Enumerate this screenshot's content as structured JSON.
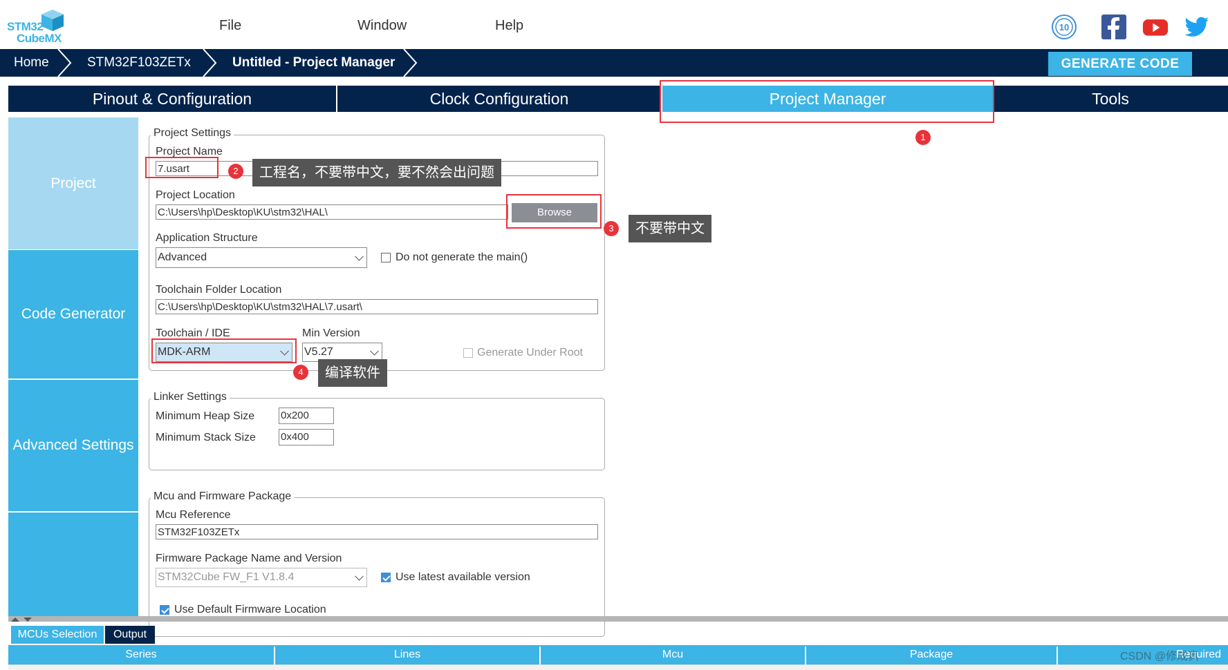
{
  "app": {
    "logo_line1": "STM32",
    "logo_line2": "CubeMX",
    "menu": [
      "File",
      "Window",
      "Help"
    ]
  },
  "breadcrumb": [
    "Home",
    "STM32F103ZETx",
    "Untitled - Project Manager"
  ],
  "generate_button": "GENERATE CODE",
  "tabs": [
    "Pinout & Configuration",
    "Clock Configuration",
    "Project Manager",
    "Tools"
  ],
  "sidebar": [
    "Project",
    "Code Generator",
    "Advanced Settings"
  ],
  "project_settings": {
    "legend": "Project Settings",
    "name_label": "Project Name",
    "name_value": "7.usart",
    "location_label": "Project Location",
    "location_value": "C:\\Users\\hp\\Desktop\\KU\\stm32\\HAL\\",
    "browse_label": "Browse",
    "app_structure_label": "Application Structure",
    "app_structure_value": "Advanced",
    "no_main_label": "Do not generate the main()",
    "toolchain_folder_label": "Toolchain Folder Location",
    "toolchain_folder_value": "C:\\Users\\hp\\Desktop\\KU\\stm32\\HAL\\7.usart\\",
    "toolchain_label": "Toolchain / IDE",
    "toolchain_value": "MDK-ARM",
    "min_version_label": "Min Version",
    "min_version_value": "V5.27",
    "gen_under_root_label": "Generate Under Root"
  },
  "linker_settings": {
    "legend": "Linker Settings",
    "heap_label": "Minimum Heap Size",
    "heap_value": "0x200",
    "stack_label": "Minimum Stack Size",
    "stack_value": "0x400"
  },
  "mcu_package": {
    "legend": "Mcu and Firmware Package",
    "ref_label": "Mcu Reference",
    "ref_value": "STM32F103ZETx",
    "fw_label": "Firmware Package Name and Version",
    "fw_value": "STM32Cube FW_F1 V1.8.4",
    "latest_label": "Use latest available version",
    "default_loc_label": "Use Default Firmware Location"
  },
  "annotations": {
    "n1": "1",
    "n2": "2",
    "n3": "3",
    "n4": "4",
    "tip2": "工程名，不要带中文，要不然会出问题",
    "tip3": "不要带中文",
    "tip4": "编译软件"
  },
  "bottom": {
    "tabs": [
      "MCUs Selection",
      "Output"
    ],
    "columns": [
      "Series",
      "Lines",
      "Mcu",
      "Package",
      "Required"
    ],
    "watermark": "CSDN @修成真"
  },
  "colors": {
    "navy": "#03234b",
    "accent": "#3cb4e5",
    "sidebar_selected": "#a6d9f1",
    "annotation_red": "#e8333b"
  }
}
